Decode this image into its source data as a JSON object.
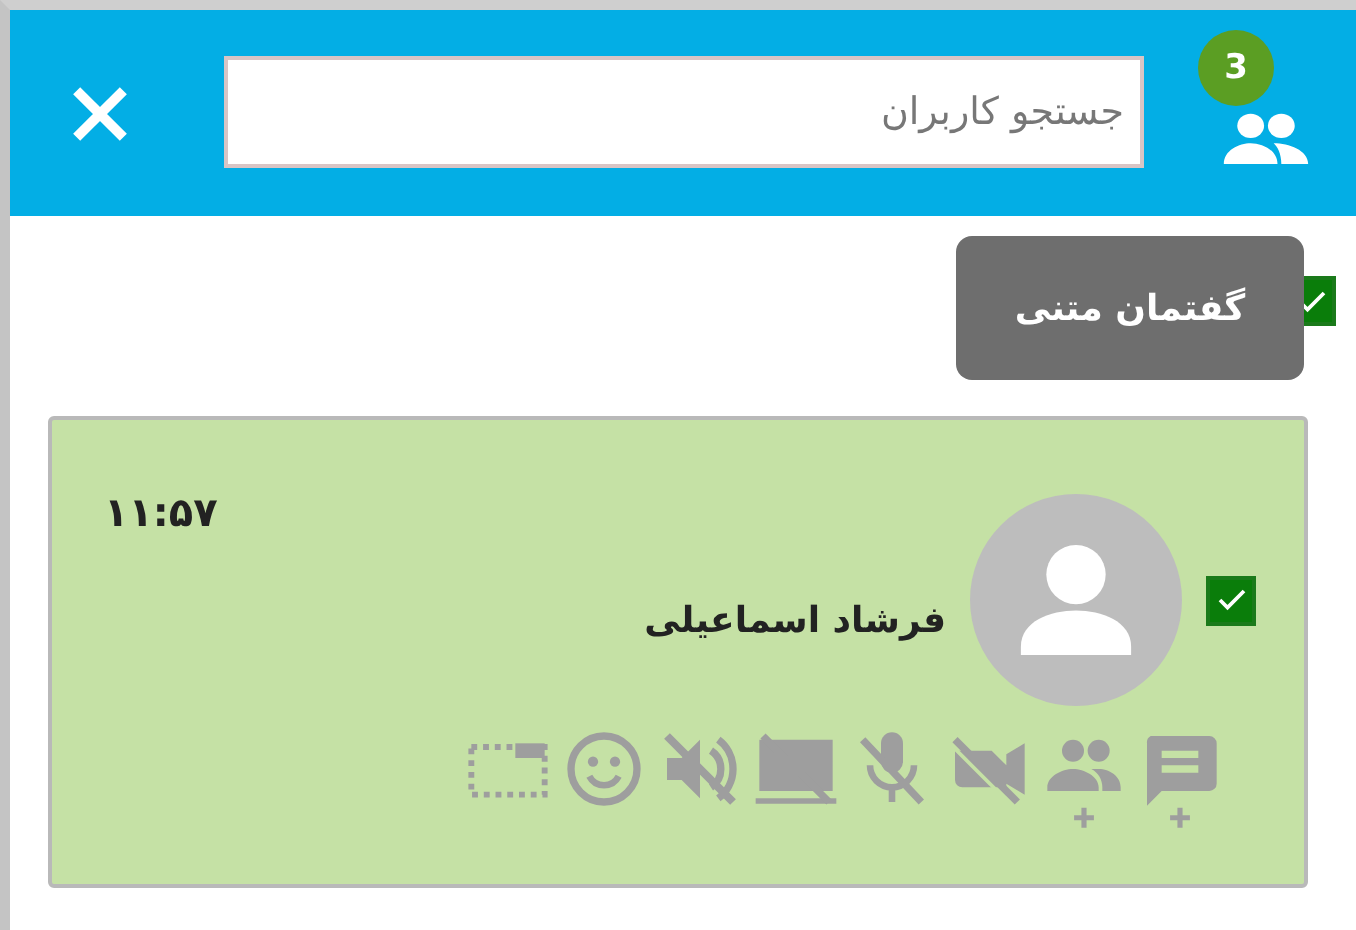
{
  "header": {
    "search": {
      "placeholder": "جستجو کاربران"
    },
    "online_count": "3"
  },
  "tooltip": "گفتمان متنی",
  "select_all": {
    "checked": true
  },
  "users": [
    {
      "name": "فرشاد اسماعیلی",
      "time": "۱۱:۵۷",
      "checked": true,
      "highlighted": true
    }
  ]
}
